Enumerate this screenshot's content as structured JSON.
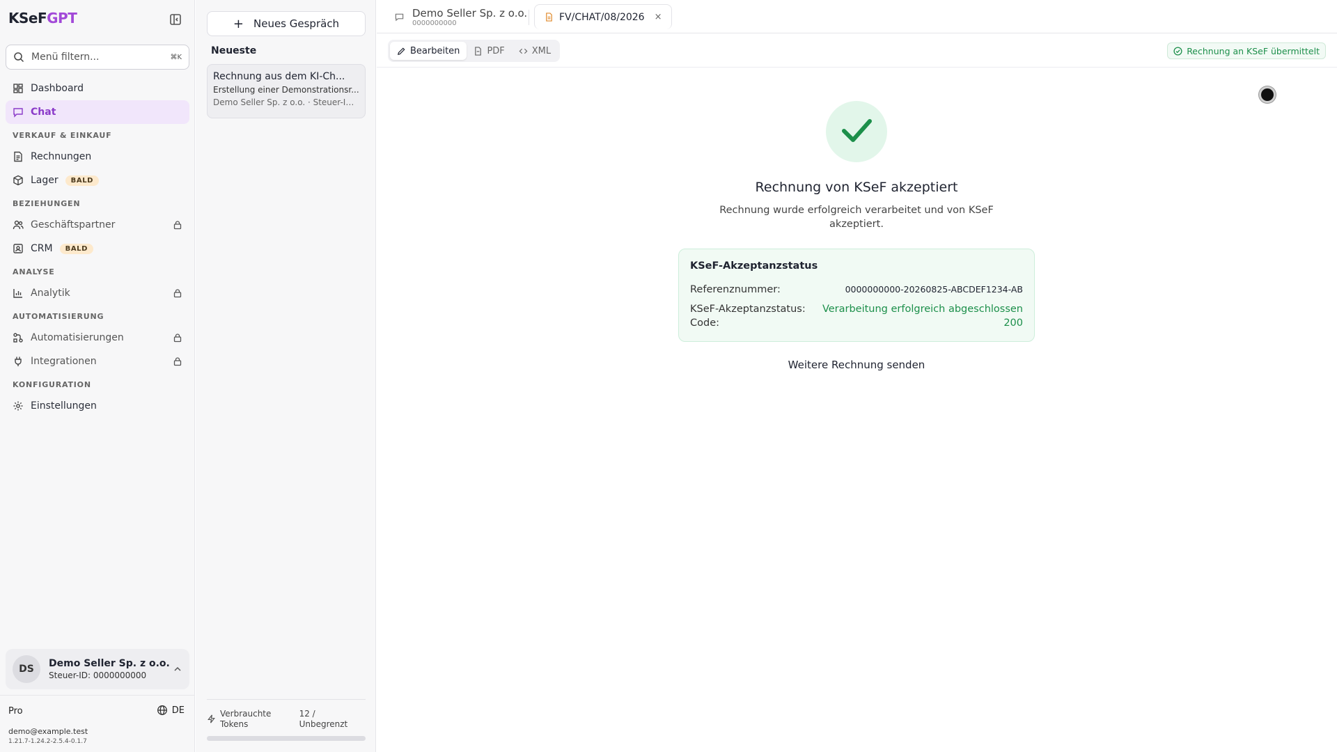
{
  "app": {
    "logo_prefix": "KSeF",
    "logo_suffix": "GPT",
    "brand_color": "#a249d8"
  },
  "search": {
    "placeholder": "Menü filtern...",
    "shortcut": "⌘K"
  },
  "nav": {
    "top": [
      {
        "label": "Dashboard",
        "icon": "dashboard-icon"
      },
      {
        "label": "Chat",
        "icon": "chat-icon",
        "active": true
      }
    ],
    "sections": [
      {
        "title": "VERKAUF & EINKAUF",
        "items": [
          {
            "label": "Rechnungen",
            "icon": "invoice-icon"
          },
          {
            "label": "Lager",
            "icon": "box-icon",
            "badge": "BALD"
          }
        ]
      },
      {
        "title": "BEZIEHUNGEN",
        "items": [
          {
            "label": "Geschäftspartner",
            "icon": "users-icon",
            "locked": true
          },
          {
            "label": "CRM",
            "icon": "contact-icon",
            "badge": "BALD"
          }
        ]
      },
      {
        "title": "ANALYSE",
        "items": [
          {
            "label": "Analytik",
            "icon": "bar-chart-icon",
            "locked": true
          }
        ]
      },
      {
        "title": "AUTOMATISIERUNG",
        "items": [
          {
            "label": "Automatisierungen",
            "icon": "workflow-icon",
            "locked": true
          },
          {
            "label": "Integrationen",
            "icon": "plug-icon",
            "locked": true
          }
        ]
      },
      {
        "title": "KONFIGURATION",
        "items": [
          {
            "label": "Einstellungen",
            "icon": "gear-icon"
          }
        ]
      }
    ]
  },
  "account": {
    "initials": "DS",
    "name": "Demo Seller Sp. z o.o.",
    "tax_id": "Steuer-ID: 0000000000"
  },
  "footer": {
    "plan": "Pro",
    "language": "DE",
    "email": "demo@example.test",
    "version": "1.21.7-1.24.2-2.5.4-0.1.7"
  },
  "conversations": {
    "new_label": "Neues Gespräch",
    "recent_heading": "Neueste",
    "items": [
      {
        "title": "Rechnung aus dem KI-Ch...",
        "subtitle": "Erstellung einer Demonstrationsr...",
        "meta": "Demo Seller Sp. z o.o. · Steuer-ID: ..."
      }
    ],
    "tokens_label": "Verbrauchte Tokens",
    "tokens_value": "12 / Unbegrenzt"
  },
  "tabs": {
    "company_title": "Demo Seller Sp. z o.o.",
    "company_sub": "0000000000",
    "document_title": "FV/CHAT/08/2026",
    "close": "×"
  },
  "toolbar": {
    "edit": "Bearbeiten",
    "pdf": "PDF",
    "xml": "XML",
    "status": "Rechnung an KSeF übermittelt"
  },
  "result": {
    "title": "Rechnung von KSeF akzeptiert",
    "description": "Rechnung wurde erfolgreich verarbeitet und von KSeF akzeptiert.",
    "card_heading": "KSeF-Akzeptanzstatus",
    "reference_label": "Referenznummer:",
    "reference_value": "0000000000-20260825-ABCDEF1234-AB",
    "status_label": "KSeF-Akzeptanzstatus:",
    "code_label": "Code:",
    "status_value": "Verarbeitung erfolgreich abgeschlossen",
    "code_value": "200",
    "send_more": "Weitere Rechnung senden"
  },
  "colors": {
    "success": "#1c8f4a",
    "active_nav_bg": "#f1e6fb",
    "badge_bg": "#fde9cc"
  }
}
